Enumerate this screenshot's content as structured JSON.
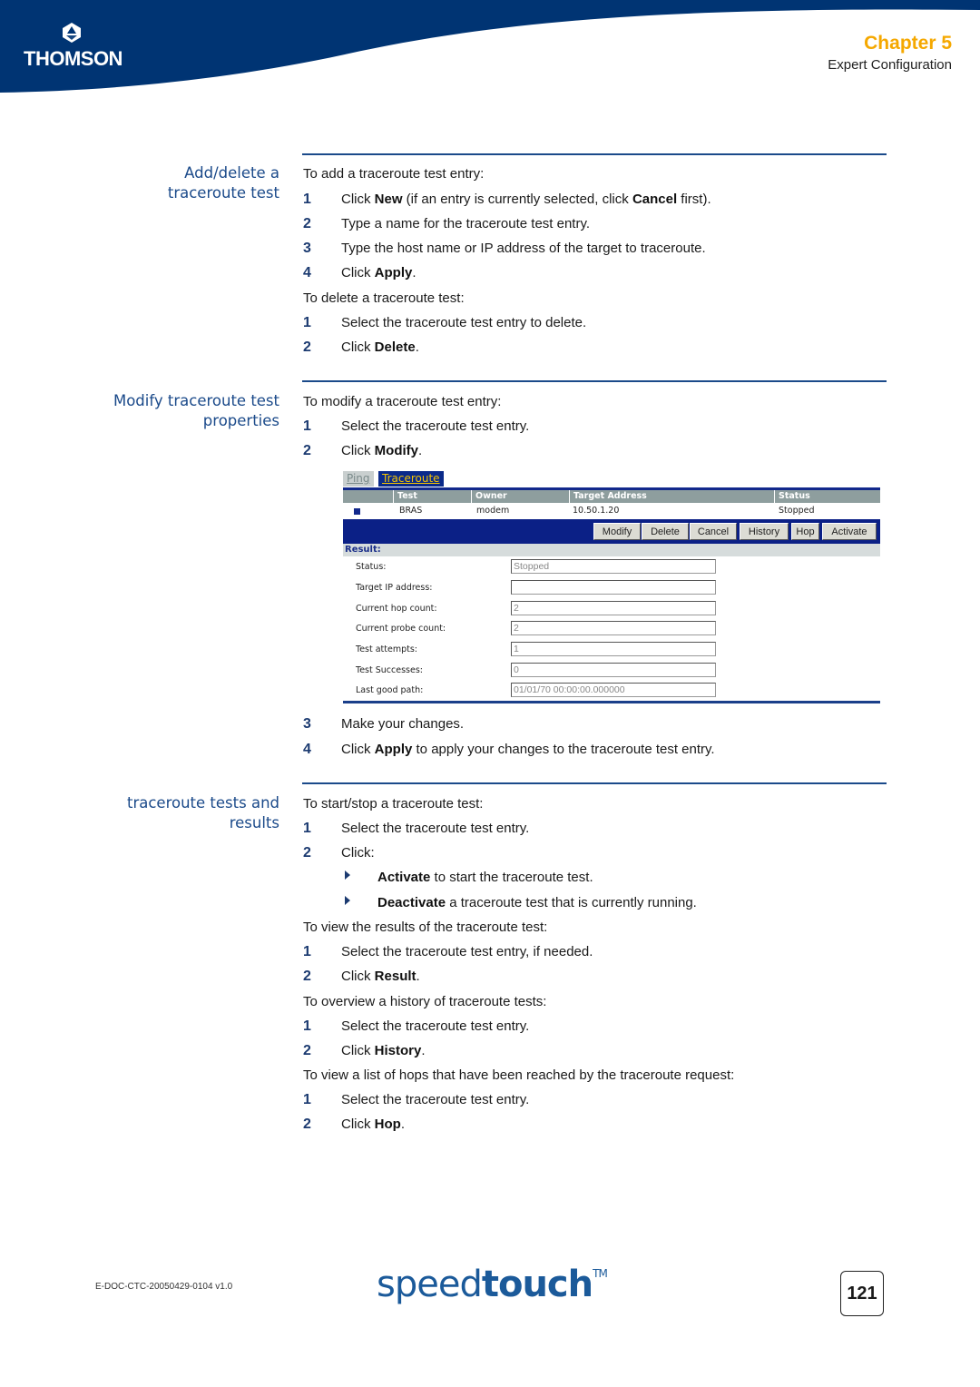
{
  "header": {
    "logo_text": "THOMSON",
    "chapter": "Chapter 5",
    "chapter_subtitle": "Expert Configuration",
    "brand_color": "#003473",
    "accent_color": "#f5a800"
  },
  "sections": [
    {
      "title_line1": "Add/delete a",
      "title_line2": "traceroute test",
      "intro_add": "To add a traceroute test entry:",
      "add_steps": [
        {
          "num": "1",
          "pre": "Click ",
          "b1": "New",
          "mid": " (if an entry is currently selected, click ",
          "b2": "Cancel",
          "post": " first)."
        },
        {
          "num": "2",
          "text": "Type a name for the traceroute test entry."
        },
        {
          "num": "3",
          "text": "Type the host name or IP address of the target to traceroute."
        },
        {
          "num": "4",
          "pre": "Click ",
          "b1": "Apply",
          "post": "."
        }
      ],
      "intro_delete": "To delete a traceroute test:",
      "delete_steps": [
        {
          "num": "1",
          "text": "Select the traceroute test entry to delete."
        },
        {
          "num": "2",
          "pre": "Click ",
          "b1": "Delete",
          "post": "."
        }
      ]
    },
    {
      "title_line1": "Modify traceroute test",
      "title_line2": "properties",
      "intro": "To modify a traceroute test entry:",
      "steps_before": [
        {
          "num": "1",
          "text": "Select the traceroute test entry."
        },
        {
          "num": "2",
          "pre": "Click ",
          "b1": "Modify",
          "post": "."
        }
      ],
      "steps_after": [
        {
          "num": "3",
          "text": "Make your changes."
        },
        {
          "num": "4",
          "pre": "Click ",
          "b1": "Apply",
          "post": " to apply your changes to the traceroute test entry."
        }
      ]
    },
    {
      "title_line1": "traceroute tests and",
      "title_line2": "results",
      "intro_start": "To start/stop a traceroute test:",
      "start_steps": [
        {
          "num": "1",
          "text": "Select the traceroute test entry."
        },
        {
          "num": "2",
          "text": "Click:"
        }
      ],
      "bullets": [
        {
          "b1": "Activate",
          "post": " to start the traceroute test."
        },
        {
          "b1": "Deactivate",
          "post": " a traceroute test that is currently running."
        }
      ],
      "intro_results": "To view the results of the traceroute test:",
      "results_steps": [
        {
          "num": "1",
          "text": "Select the traceroute test entry, if needed."
        },
        {
          "num": "2",
          "pre": "Click ",
          "b1": "Result",
          "post": "."
        }
      ],
      "intro_history": "To overview a history of traceroute tests:",
      "history_steps": [
        {
          "num": "1",
          "text": "Select the traceroute test entry."
        },
        {
          "num": "2",
          "pre": "Click ",
          "b1": "History",
          "post": "."
        }
      ],
      "intro_hops": "To view a list of hops that have been reached by the traceroute request:",
      "hop_steps": [
        {
          "num": "1",
          "text": "Select the traceroute test entry."
        },
        {
          "num": "2",
          "pre": "Click ",
          "b1": "Hop",
          "post": "."
        }
      ]
    }
  ],
  "screenshot": {
    "tabs": [
      "Ping",
      "Traceroute"
    ],
    "active_tab": "Traceroute",
    "columns": [
      "Test",
      "Owner",
      "Target Address",
      "Status"
    ],
    "row": {
      "test": "BRAS",
      "owner": "modem",
      "target": "10.50.1.20",
      "status": "Stopped"
    },
    "buttons": [
      "Modify",
      "Delete",
      "Cancel",
      "History",
      "Hop",
      "Activate"
    ],
    "result_heading": "Result:",
    "fields": [
      {
        "label": "Status:",
        "value": "Stopped"
      },
      {
        "label": "Target IP address:",
        "value": ""
      },
      {
        "label": "Current hop count:",
        "value": "2"
      },
      {
        "label": "Current probe count:",
        "value": "2"
      },
      {
        "label": "Test attempts:",
        "value": "1"
      },
      {
        "label": "Test Successes:",
        "value": "0"
      },
      {
        "label": "Last good path:",
        "value": "01/01/70 00:00:00.000000"
      }
    ]
  },
  "footer": {
    "doc_id": "E-DOC-CTC-20050429-0104 v1.0",
    "brand_light": "speed",
    "brand_bold": "touch",
    "brand_tm": "TM",
    "page_number": "121"
  }
}
